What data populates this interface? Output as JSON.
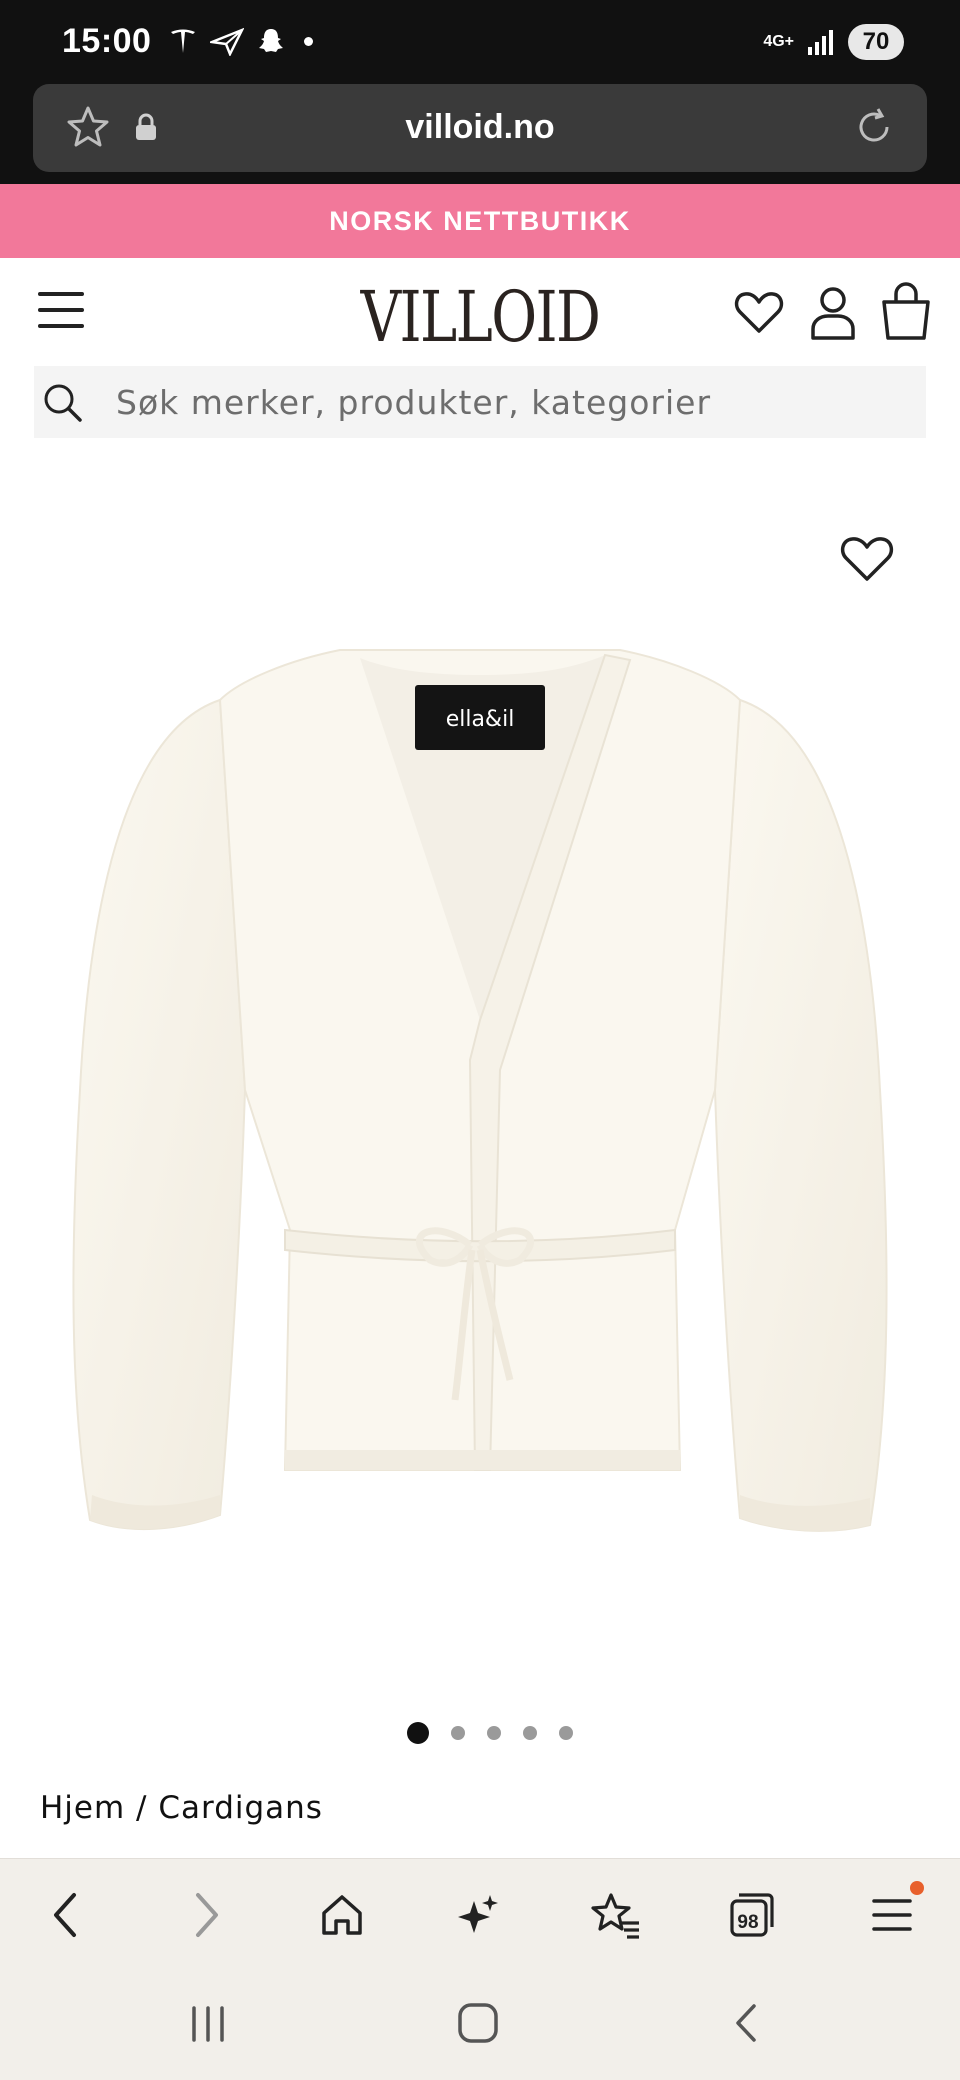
{
  "status_bar": {
    "time": "15:00",
    "network": "4G+",
    "battery": "70"
  },
  "address_bar": {
    "url": "villoid.no"
  },
  "promo_banner": {
    "text": "NORSK NETTBUTIKK"
  },
  "header": {
    "logo": "VILLOID"
  },
  "search": {
    "placeholder": "Søk merker, produkter, kategorier"
  },
  "product": {
    "label_text": "ella&il",
    "image_count": 5,
    "active_image_index": 0
  },
  "breadcrumb": {
    "text": "Hjem / Cardigans"
  },
  "browser_toolbar": {
    "tabs_count": "98",
    "icons": [
      "back-icon",
      "forward-icon",
      "home-icon",
      "sparkle-icon",
      "bookmarks-icon",
      "tabs-icon",
      "menu-icon"
    ]
  },
  "colors": {
    "promo_bg": "#f2789a",
    "status_bg": "#111111",
    "toolbar_bg": "#f2efea",
    "notification_dot": "#e8602c"
  }
}
